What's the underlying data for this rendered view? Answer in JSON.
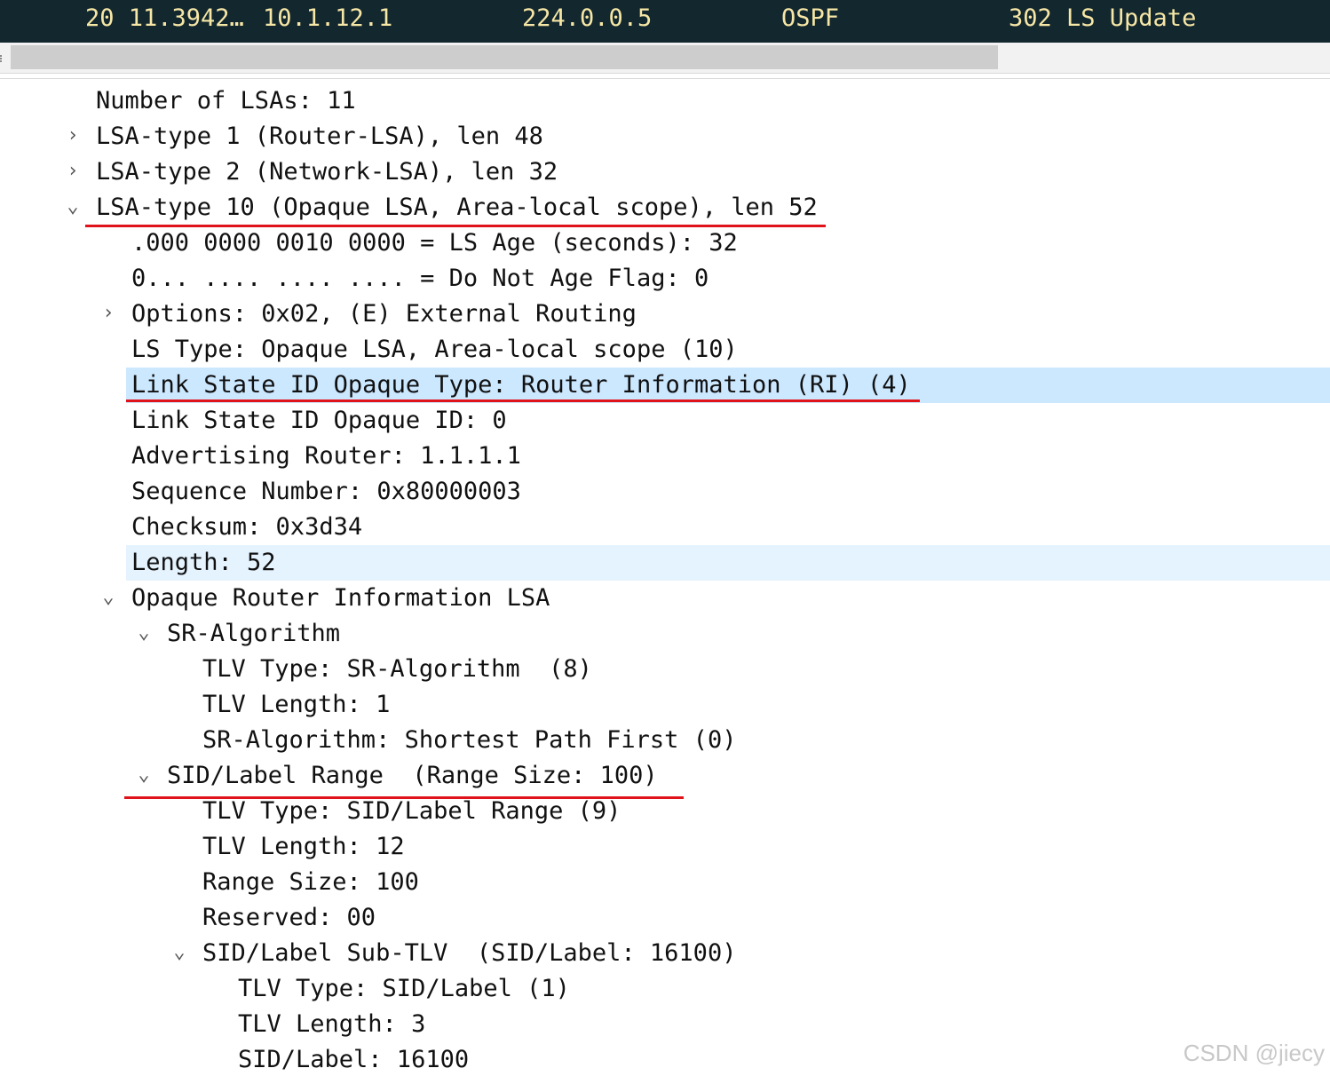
{
  "packet_row": {
    "no_time": "20 11.3942…",
    "source": "10.1.12.1",
    "destination": "224.0.0.5",
    "protocol": "OSPF",
    "info": "302 LS Update"
  },
  "tree": [
    {
      "text": "Number of LSAs: 11",
      "toggle": ""
    },
    {
      "text": "LSA-type 1 (Router-LSA), len 48",
      "toggle": "›"
    },
    {
      "text": "LSA-type 2 (Network-LSA), len 32",
      "toggle": "›"
    },
    {
      "text": "LSA-type 10 (Opaque LSA, Area-local scope), len 52",
      "toggle": "⌄"
    },
    {
      "text": ".000 0000 0010 0000 = LS Age (seconds): 32",
      "toggle": ""
    },
    {
      "text": "0... .... .... .... = Do Not Age Flag: 0",
      "toggle": ""
    },
    {
      "text": "Options: 0x02, (E) External Routing",
      "toggle": "›"
    },
    {
      "text": "LS Type: Opaque LSA, Area-local scope (10)",
      "toggle": ""
    },
    {
      "text": "Link State ID Opaque Type: Router Information (RI) (4)",
      "toggle": ""
    },
    {
      "text": "Link State ID Opaque ID: 0",
      "toggle": ""
    },
    {
      "text": "Advertising Router: 1.1.1.1",
      "toggle": ""
    },
    {
      "text": "Sequence Number: 0x80000003",
      "toggle": ""
    },
    {
      "text": "Checksum: 0x3d34",
      "toggle": ""
    },
    {
      "text": "Length: 52",
      "toggle": ""
    },
    {
      "text": "Opaque Router Information LSA",
      "toggle": "⌄"
    },
    {
      "text": "SR-Algorithm",
      "toggle": "⌄"
    },
    {
      "text": "TLV Type: SR-Algorithm  (8)",
      "toggle": ""
    },
    {
      "text": "TLV Length: 1",
      "toggle": ""
    },
    {
      "text": "SR-Algorithm: Shortest Path First (0)",
      "toggle": ""
    },
    {
      "text": "SID/Label Range  (Range Size: 100)",
      "toggle": "⌄"
    },
    {
      "text": "TLV Type: SID/Label Range (9)",
      "toggle": ""
    },
    {
      "text": "TLV Length: 12",
      "toggle": ""
    },
    {
      "text": "Range Size: 100",
      "toggle": ""
    },
    {
      "text": "Reserved: 00",
      "toggle": ""
    },
    {
      "text": "SID/Label Sub-TLV  (SID/Label: 16100)",
      "toggle": "⌄"
    },
    {
      "text": "TLV Type: SID/Label (1)",
      "toggle": ""
    },
    {
      "text": "TLV Length: 3",
      "toggle": ""
    },
    {
      "text": "SID/Label: 16100",
      "toggle": ""
    }
  ],
  "watermark": "CSDN @jiecy",
  "colors": {
    "packet_bg": "#12272e",
    "packet_fg": "#f7e7a6",
    "selected_row": "#cce8ff",
    "related_row": "#e5f3ff",
    "annotation_red": "#e0121a"
  }
}
